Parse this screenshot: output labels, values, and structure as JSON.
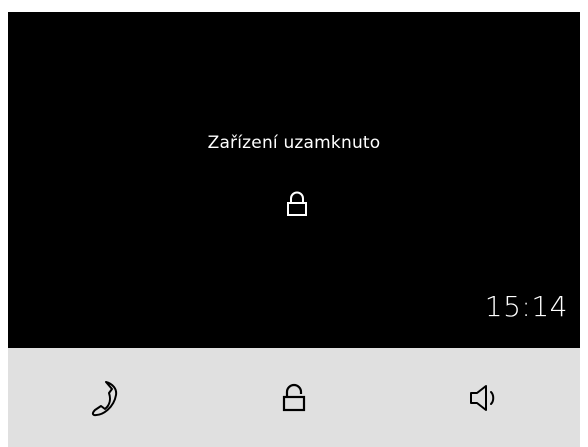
{
  "screen": {
    "status_text": "Zařízení uzamknuto",
    "clock": "15:14",
    "center_icon": "lock-icon"
  },
  "bottom_bar": {
    "buttons": [
      {
        "icon": "phone-handset-icon"
      },
      {
        "icon": "lock-icon"
      },
      {
        "icon": "speaker-icon"
      }
    ]
  },
  "colors": {
    "screen_bg": "#000000",
    "text": "#ffffff",
    "bar_bg": "#e0e0e0",
    "icon": "#000000"
  }
}
